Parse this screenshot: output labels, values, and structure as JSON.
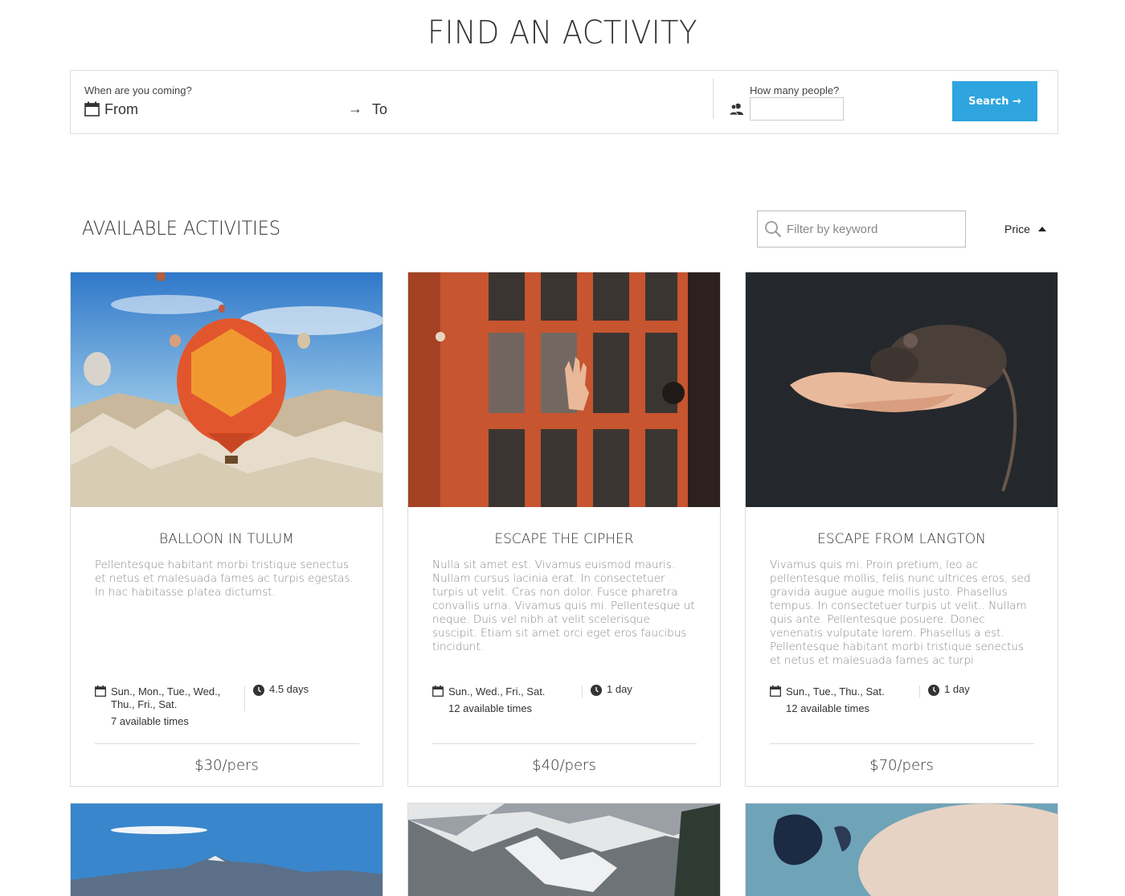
{
  "header": {
    "title": "FIND AN ACTIVITY"
  },
  "search_bar": {
    "when_label": "When are you coming?",
    "from_label": "From",
    "to_label": "To",
    "people_label": "How many people?",
    "people_value": "",
    "search_button": "Search →",
    "icons": {
      "calendar": "calendar-icon",
      "arrow": "arrow-right-icon",
      "people": "people-icon"
    }
  },
  "results": {
    "title": "AVAILABLE ACTIVITIES",
    "filter_placeholder": "Filter by keyword",
    "sort_label": "Price",
    "sort_direction": "ascending"
  },
  "activities": [
    {
      "title": "BALLOON IN TULUM",
      "description": "Pellentesque habitant morbi tristique senectus et netus et malesuada fames ac turpis egestas. In hac habitasse platea dictumst.",
      "days": "Sun., Mon., Tue., Wed., Thu., Fri., Sat.",
      "times": "7 available times",
      "duration": "4.5 days",
      "price": "$30/pers"
    },
    {
      "title": "ESCAPE THE CIPHER",
      "description": "Nulla sit amet est. Vivamus euismod mauris. Nullam cursus lacinia erat. In consectetuer turpis ut velit. Cras non dolor. Fusce pharetra convallis urna. Vivamus quis mi. Pellentesque ut neque. Duis vel nibh at velit scelerisque suscipit. Etiam sit amet orci eget eros faucibus tincidunt.",
      "days": "Sun., Wed., Fri., Sat.",
      "times": "12 available times",
      "duration": "1 day",
      "price": "$40/pers"
    },
    {
      "title": "ESCAPE FROM LANGTON",
      "description": "Vivamus quis mi. Proin pretium, leo ac pellentesque mollis, felis nunc ultrices eros, sed gravida augue augue mollis justo. Phasellus tempus. In consectetuer turpis ut velit.. Nullam quis ante. Pellentesque posuere. Donec venenatis vulputate lorem. Phasellus a est. Pellentesque habitant morbi tristique senectus et netus et malesuada fames ac turpi",
      "days": "Sun., Tue., Thu., Sat.",
      "times": "12 available times",
      "duration": "1 day",
      "price": "$70/pers"
    }
  ]
}
